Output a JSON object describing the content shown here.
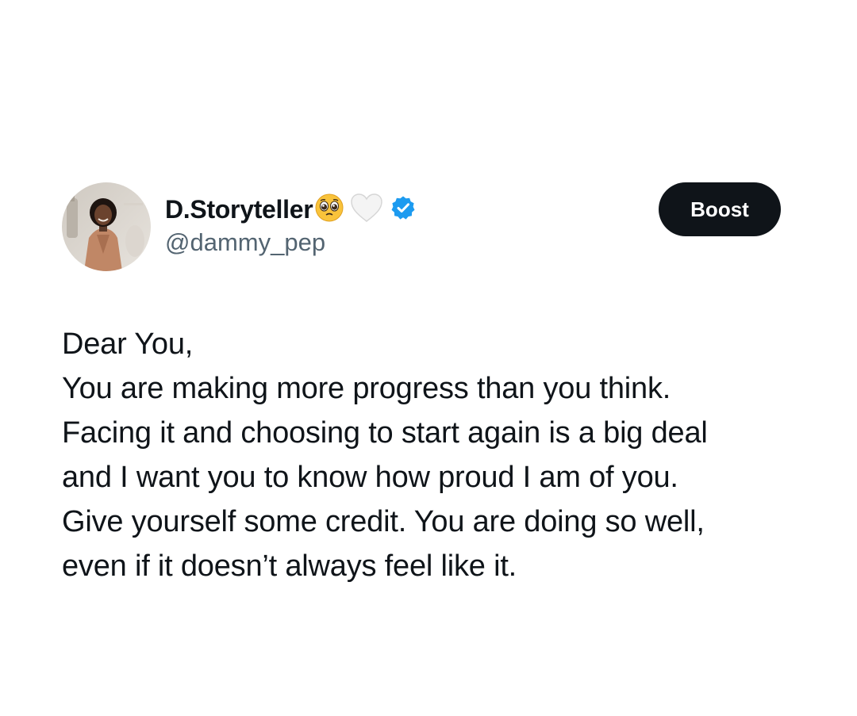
{
  "author": {
    "display_name": "D.Storyteller",
    "handle": "@dammy_pep",
    "emojis": [
      "pleading-face-emoji",
      "white-heart-emoji"
    ],
    "verified": true,
    "verified_badge_color": "#1d9bf0"
  },
  "actions": {
    "boost_label": "Boost"
  },
  "post": {
    "lines": [
      "Dear You,",
      "You are making more progress than you think.",
      "Facing it and choosing to start again is a big deal",
      "and I want you to know how proud I am of you.",
      "Give yourself some credit. You are doing so well,",
      "even if it doesn’t always feel like it."
    ]
  },
  "colors": {
    "background": "#ffffff",
    "text": "#0f1419",
    "secondary_text": "#536471",
    "button_bg": "#0f1419",
    "button_text": "#ffffff"
  }
}
